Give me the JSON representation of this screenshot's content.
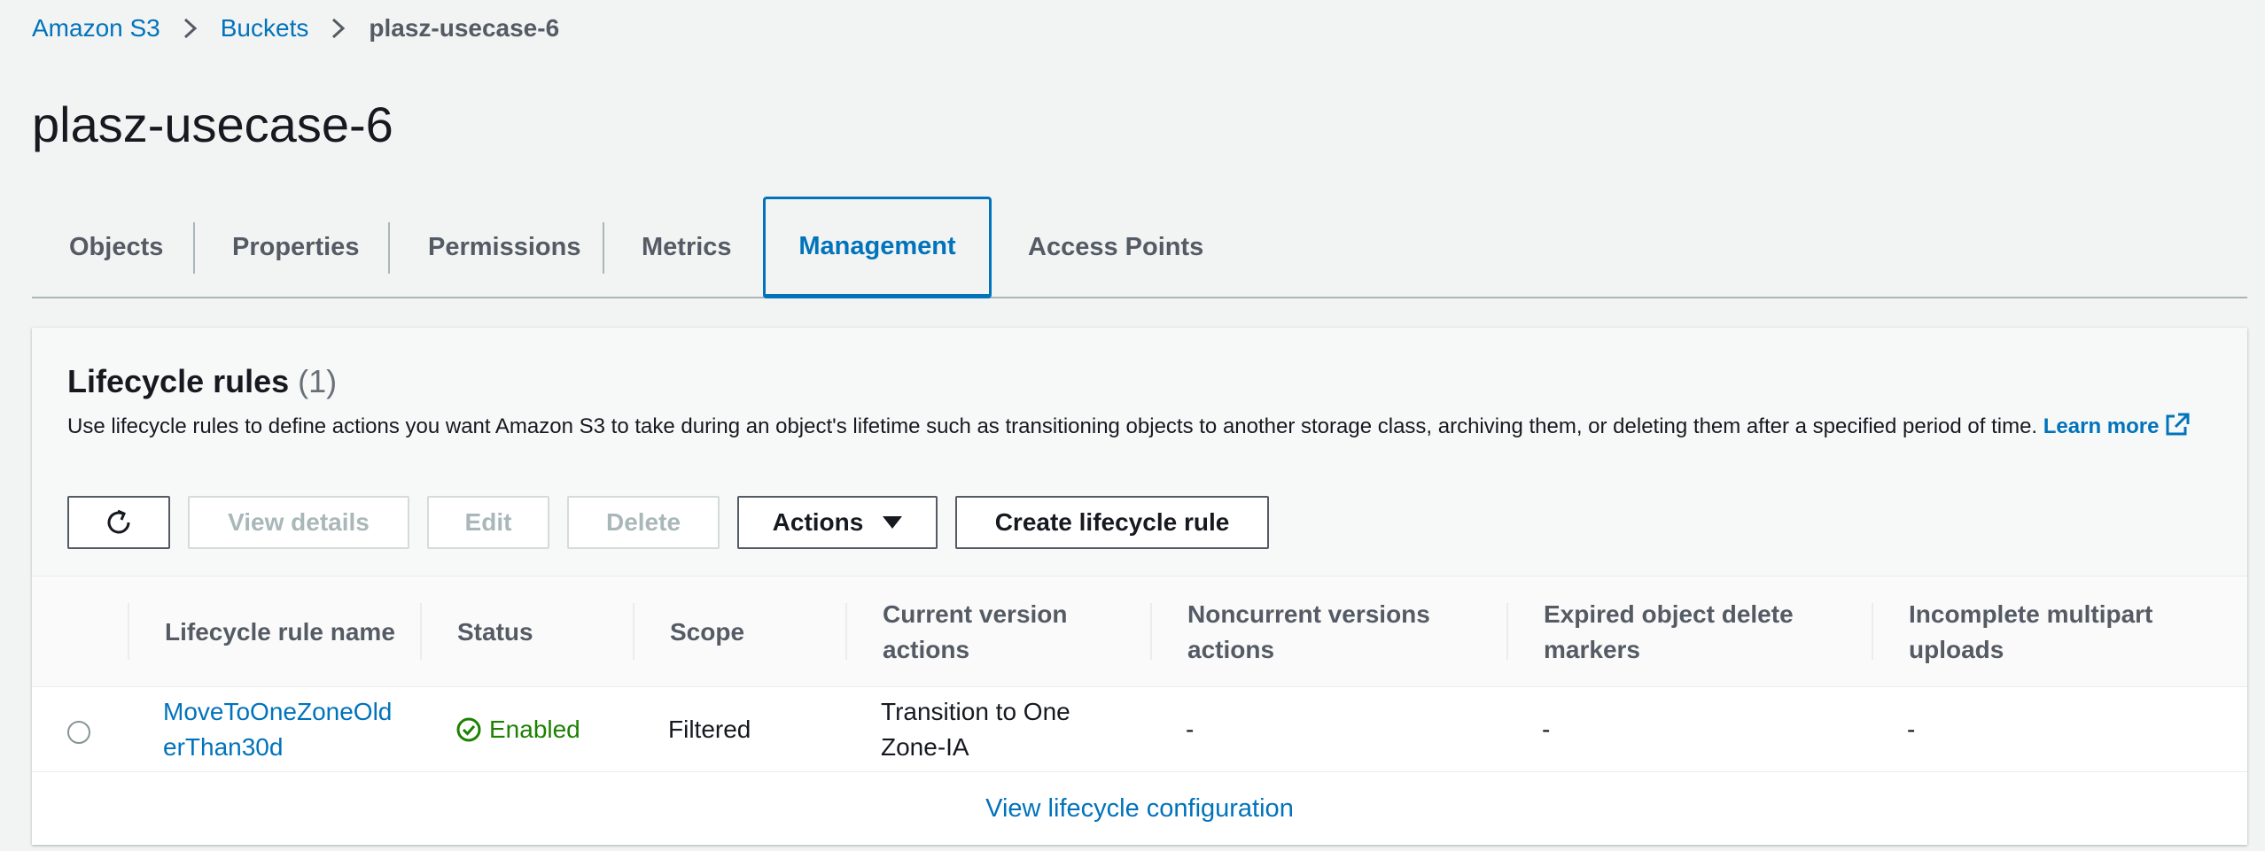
{
  "breadcrumb": {
    "items": [
      "Amazon S3",
      "Buckets"
    ],
    "current": "plasz-usecase-6"
  },
  "page": {
    "title": "plasz-usecase-6"
  },
  "tabs": [
    "Objects",
    "Properties",
    "Permissions",
    "Metrics",
    "Management",
    "Access Points"
  ],
  "active_tab": "Management",
  "lifecycle": {
    "title": "Lifecycle rules",
    "count": "(1)",
    "description": "Use lifecycle rules to define actions you want Amazon S3 to take during an object's lifetime such as transitioning objects to another storage class, archiving them, or deleting them after a specified period of time.",
    "learn_more": "Learn more",
    "buttons": {
      "refresh": "refresh-icon",
      "view_details": "View details",
      "edit": "Edit",
      "delete": "Delete",
      "actions": "Actions",
      "create": "Create lifecycle rule"
    },
    "columns": [
      "Lifecycle rule name",
      "Status",
      "Scope",
      "Current version actions",
      "Noncurrent versions actions",
      "Expired object delete markers",
      "Incomplete multipart uploads"
    ],
    "rows": [
      {
        "name": "MoveToOneZoneOlderThan30d",
        "status": "Enabled",
        "scope": "Filtered",
        "current_actions": "Transition to One Zone-IA",
        "noncurrent_actions": "-",
        "expired_markers": "-",
        "incomplete_uploads": "-"
      }
    ],
    "footer_link": "View lifecycle configuration"
  },
  "colors": {
    "link": "#0073bb",
    "success": "#1d8102",
    "background": "#f2f3f3"
  }
}
